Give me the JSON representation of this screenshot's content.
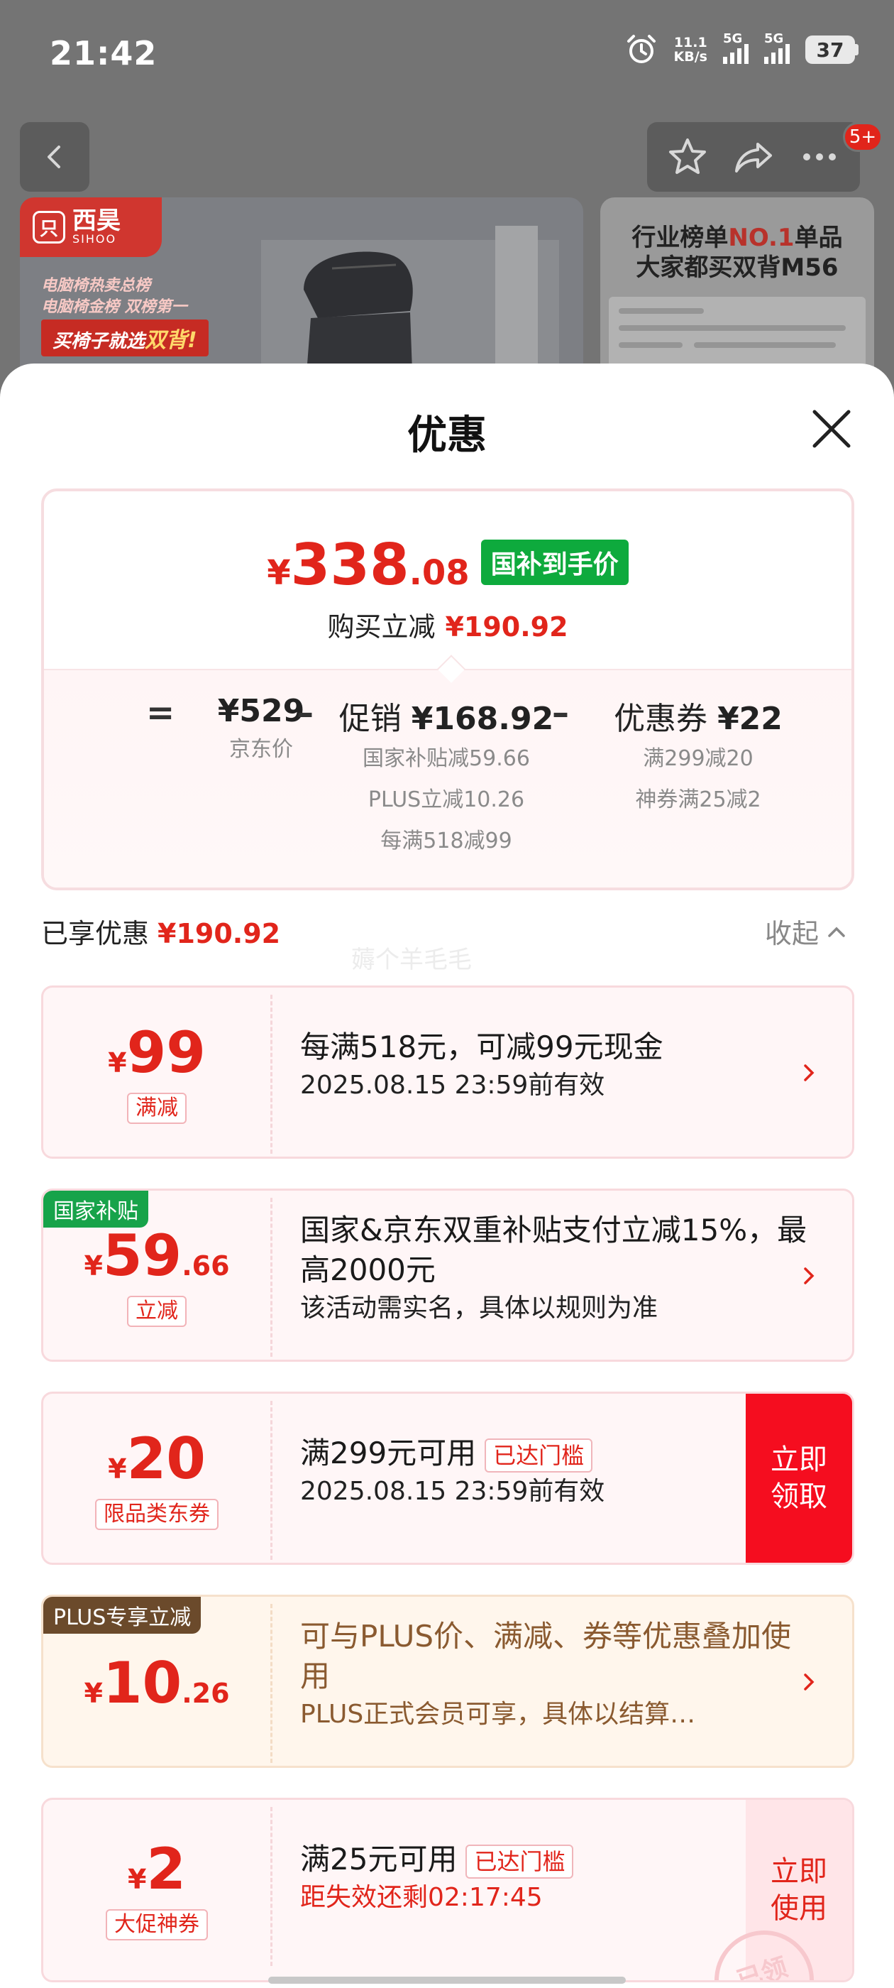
{
  "status_bar": {
    "time": "21:42",
    "net_speed_value": "11.1",
    "net_speed_unit": "KB/s",
    "sim1": "5G",
    "sim2": "5G",
    "battery": "37"
  },
  "nav": {
    "badge": "5+"
  },
  "banner": {
    "brand_name": "西昊",
    "brand_sub": "SIHOO",
    "brand_mark": "只",
    "promo_line1": "电脑椅热卖总榜",
    "promo_line2": "电脑椅金榜 双榜第一",
    "promo_tag_prefix": "买椅子就选",
    "promo_tag_highlight": "双背!",
    "rank_line1_pre": "行业榜单",
    "rank_line1_em": "NO.1",
    "rank_line1_post": "单品",
    "rank_line2": "大家都买双背M56"
  },
  "sheet": {
    "title": "优惠",
    "summary": {
      "final_yen": "¥",
      "final_int": "338",
      "final_dec": ".08",
      "final_badge": "国补到手价",
      "reduce_label": "购买立减",
      "reduce_value": "¥190.92",
      "eq": "=",
      "minus": "–",
      "jd_price": "¥529",
      "jd_price_label": "京东价",
      "promo_label": "促销",
      "promo_value": "¥168.92",
      "promo_items": [
        "国家补贴减59.66",
        "PLUS立减10.26",
        "每满518减99"
      ],
      "coupon_label": "优惠券",
      "coupon_value": "¥22",
      "coupon_items": [
        "满299减20",
        "神券满25减2"
      ]
    },
    "enjoyed_label": "已享优惠",
    "enjoyed_value": "¥190.92",
    "collapse_label": "收起",
    "watermark": "薅个羊毛毛",
    "cards": [
      {
        "yen": "¥",
        "int": "99",
        "dec": "",
        "pill": "满减",
        "main": "每满518元，可减99元现金",
        "sub": "2025.08.15 23:59前有效"
      },
      {
        "tag": "国家补贴",
        "yen": "¥",
        "int": "59",
        "dec": ".66",
        "pill": "立减",
        "main": "国家&京东双重补贴支付立减15%，最高2000元",
        "sub": "该活动需实名，具体以规则为准"
      },
      {
        "yen": "¥",
        "int": "20",
        "dec": "",
        "pill": "限品类东券",
        "main": "满299元可用",
        "threshold": "已达门槛",
        "sub": "2025.08.15 23:59前有效",
        "action": "立即领取"
      },
      {
        "tag": "PLUS专享立减",
        "yen": "¥",
        "int": "10",
        "dec": ".26",
        "main": "可与PLUS价、满减、券等优惠叠加使用",
        "sub": "PLUS正式会员可享，具体以结算…"
      },
      {
        "yen": "¥",
        "int": "2",
        "dec": "",
        "pill": "大促神券",
        "main": "满25元可用",
        "threshold": "已达门槛",
        "sub": "距失效还剩02:17:45",
        "action": "立即使用",
        "stamp": "已领"
      }
    ]
  },
  "colors": {
    "accent_red": "#e1251b",
    "claim_red": "#f50d1f",
    "subsidy_green": "#0eaa3d",
    "plus_brown": "#6b4a2b"
  },
  "icons": [
    "back-chevron-icon",
    "star-outline-icon",
    "share-icon",
    "more-dots-icon",
    "close-icon",
    "chevron-up-icon",
    "chevron-right-icon",
    "alarm-clock-icon"
  ]
}
